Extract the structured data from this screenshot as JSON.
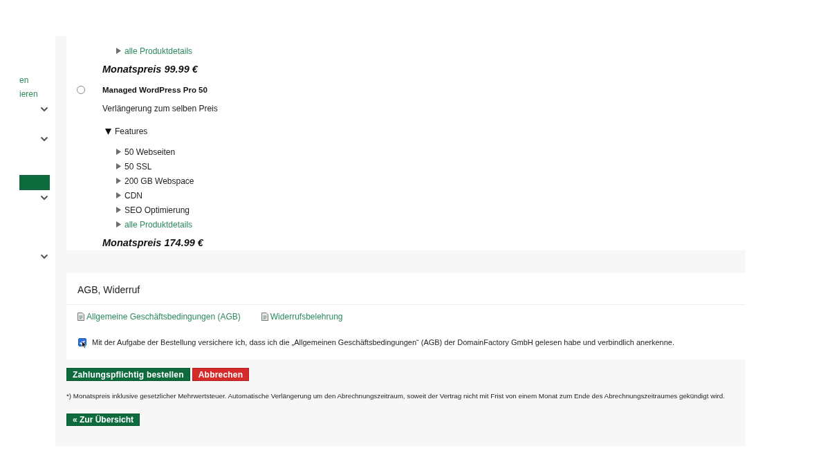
{
  "sidebar": {
    "links": [
      {
        "label": "en"
      },
      {
        "label": "ieren"
      }
    ],
    "items": [
      {
        "kind": "toggle",
        "expanded": false
      },
      {
        "kind": "toggle",
        "expanded": false
      },
      {
        "kind": "button"
      },
      {
        "kind": "toggle",
        "expanded": false
      },
      {
        "kind": "toggle",
        "expanded": false
      }
    ]
  },
  "offer": {
    "cut_off_product": {
      "details_link": "alle Produktdetails",
      "price": "Monatspreis 99.99 €"
    },
    "products": [
      {
        "selected": false,
        "name": "Managed WordPress Pro 50",
        "renewal": "Verlängerung zum selben Preis",
        "features": {
          "label": "Features",
          "expanded": true,
          "items": [
            "50 Webseiten",
            "50 SSL",
            "200 GB Webspace",
            "CDN",
            "SEO Optimierung"
          ]
        },
        "details_link": "alle Produktdetails",
        "price": "Monatspreis 174.99 €"
      }
    ]
  },
  "terms": {
    "title": "AGB, Widerruf",
    "documents": [
      {
        "label": "Allgemeine Geschäftsbedingungen (AGB)"
      },
      {
        "label": "Widerrufsbelehrung"
      }
    ],
    "consent": {
      "checked": true,
      "text": "Mit der Aufgabe der Bestellung versichere ich, dass ich die „Allgemeinen Geschäftsbedingungen“ (AGB) der DomainFactory GmbH gelesen habe und verbindlich anerkenne."
    }
  },
  "actions": [
    {
      "kind": "primary",
      "label": "Zahlungspflichtig bestellen"
    },
    {
      "kind": "danger",
      "label": "Abbrechen"
    }
  ],
  "footnote": "*) Monatspreis inklusive gesetzlicher Mehrwertsteuer. Automatische Verlängerung um den Abrechnungszeitraum, soweit der Vertrag nicht mit Frist von einem Monat zum Ende des Abrechnungszeitraumes gekündigt wird.",
  "back_button": {
    "label": "« Zur Übersicht"
  }
}
